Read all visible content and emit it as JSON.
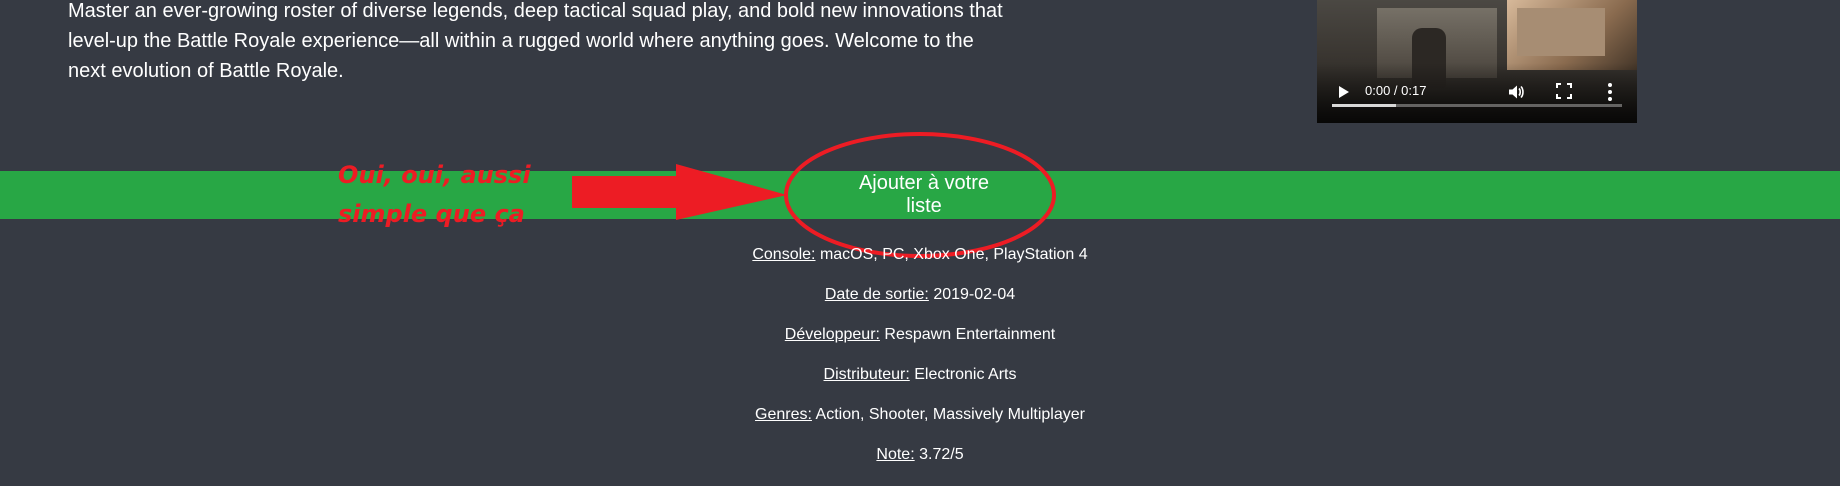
{
  "description": "Master an ever-growing roster of diverse legends, deep tactical squad play, and bold new innovations that level-up the Battle Royale experience—all within a rugged world where anything goes. Welcome to the next evolution of Battle Royale.",
  "video": {
    "time": "0:00 / 0:17",
    "buffered_fraction": 0.22,
    "icons": [
      "play-icon",
      "volume-icon",
      "fullscreen-icon",
      "more-options-icon"
    ]
  },
  "add_button": {
    "label": "Ajouter à votre liste"
  },
  "annotation": {
    "line1": "Oui, oui, aussi",
    "line2": "simple que ça",
    "color": "#ed1c24"
  },
  "details": [
    {
      "label": "Console:",
      "value": "macOS, PC, Xbox One, PlayStation 4"
    },
    {
      "label": "Date de sortie:",
      "value": "2019-02-04"
    },
    {
      "label": "Développeur:",
      "value": "Respawn Entertainment"
    },
    {
      "label": "Distributeur:",
      "value": "Electronic Arts"
    },
    {
      "label": "Genres:",
      "value": "Action, Shooter, Massively Multiplayer"
    },
    {
      "label": "Note:",
      "value": "3.72/5"
    }
  ],
  "colors": {
    "background": "#363a43",
    "accent_green": "#28a745",
    "annotation_red": "#ed1c24"
  }
}
